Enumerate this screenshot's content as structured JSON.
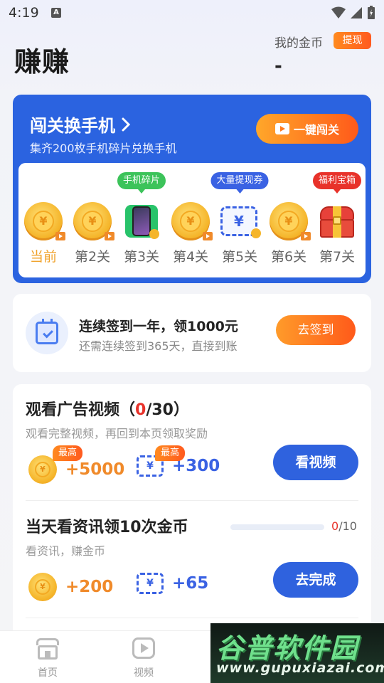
{
  "status_bar": {
    "time": "4:19",
    "notification_icon": "A"
  },
  "header": {
    "title": "赚赚",
    "coins_label": "我的金币",
    "withdraw_label": "提现",
    "coins_value": "-"
  },
  "level_card": {
    "title": "闯关换手机",
    "subtitle": "集齐200枚手机碎片兑换手机",
    "one_key_label": "一键闯关",
    "stages": [
      {
        "label": "当前",
        "icon": "coin-video-icon",
        "tag": ""
      },
      {
        "label": "第2关",
        "icon": "coin-video-icon",
        "tag": ""
      },
      {
        "label": "第3关",
        "icon": "phone-fragment-icon",
        "tag": "手机碎片",
        "tag_color": "#3cc35a"
      },
      {
        "label": "第4关",
        "icon": "coin-video-icon",
        "tag": ""
      },
      {
        "label": "第5关",
        "icon": "withdraw-ticket-icon",
        "tag": "大量提现券",
        "tag_color": "#3a62e3"
      },
      {
        "label": "第6关",
        "icon": "coin-video-icon",
        "tag": ""
      },
      {
        "label": "第7关",
        "icon": "treasure-chest-icon",
        "tag": "福利宝箱",
        "tag_color": "#e8322a"
      }
    ],
    "coin_symbol": "¥",
    "ticket_symbol": "¥"
  },
  "sign_in": {
    "title": "连续签到一年，领1000元",
    "subtitle": "还需连续签到365天，直接到账",
    "button": "去签到"
  },
  "tasks": [
    {
      "title_prefix": "观看广告视频（",
      "count": "0",
      "title_suffix": "/30）",
      "subtitle": "观看完整视频，再回到本页领取奖励",
      "coin_reward": "+5000",
      "ticket_reward": "+300",
      "max_badge": "最高",
      "button": "看视频"
    },
    {
      "title": "当天看资讯领10次金币",
      "subtitle": "看资讯，赚金币",
      "progress_done": "0",
      "progress_total": "/10",
      "progress_fraction": 0,
      "coin_reward": "+200",
      "ticket_reward": "+65",
      "button": "去完成"
    }
  ],
  "bottom_nav": {
    "items": [
      {
        "label": "首页",
        "icon": "home-icon"
      },
      {
        "label": "视频",
        "icon": "video-icon"
      }
    ]
  },
  "watermark": {
    "logo": "谷普软件园",
    "url": "www.gupuxiazai.com"
  },
  "colors": {
    "primary_blue": "#2b63e0",
    "accent_orange": "#ff7a1f",
    "highlight_red": "#e8322a",
    "current_gold": "#f0a22a"
  }
}
